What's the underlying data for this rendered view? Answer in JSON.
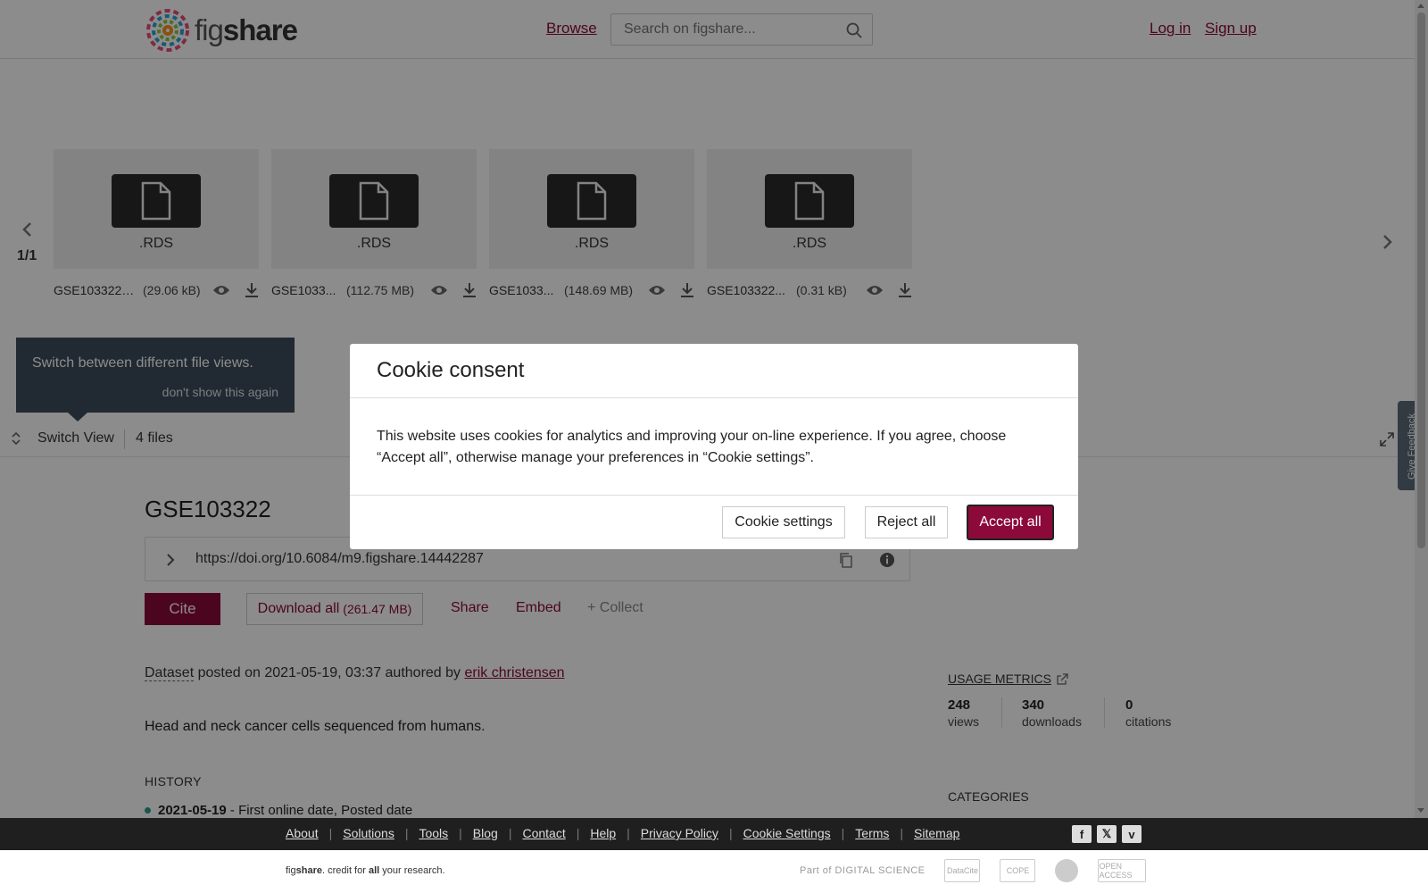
{
  "header": {
    "logo_text_light": "fig",
    "logo_text_bold": "share",
    "browse_label": "Browse",
    "search_placeholder": "Search on figshare...",
    "login_label": "Log in",
    "signup_label": "Sign up"
  },
  "carousel": {
    "page_indicator": "1/1",
    "files": [
      {
        "ext": ".RDS",
        "name": "GSE103322_...",
        "size": "(29.06 kB)"
      },
      {
        "ext": ".RDS",
        "name": "GSE1033...",
        "size": "(112.75 MB)"
      },
      {
        "ext": ".RDS",
        "name": "GSE1033...",
        "size": "(148.69 MB)"
      },
      {
        "ext": ".RDS",
        "name": "GSE103322...",
        "size": "(0.31 kB)"
      }
    ]
  },
  "tooltip": {
    "text": "Switch between different file views.",
    "dismiss": "don't show this again"
  },
  "switch_bar": {
    "label": "Switch View",
    "files_count": "4 files"
  },
  "item": {
    "title": "GSE103322",
    "doi": "https://doi.org/10.6084/m9.figshare.14442287",
    "cite_label": "Cite",
    "download_label": "Download all",
    "download_size": "(261.47 MB)",
    "share_label": "Share",
    "embed_label": "Embed",
    "collect_label": "+ Collect",
    "type": "Dataset",
    "posted_text": " posted on 2021-05-19, 03:37 authored by ",
    "author": "erik christensen",
    "description": "Head and neck cancer cells sequenced from humans.",
    "history_label": "HISTORY",
    "history_date": "2021-05-19",
    "history_text": " - First online date, Posted date"
  },
  "metrics": {
    "label": "USAGE METRICS",
    "views_value": "248",
    "views_label": "views",
    "downloads_value": "340",
    "downloads_label": "downloads",
    "citations_value": "0",
    "citations_label": "citations",
    "categories_label": "CATEGORIES"
  },
  "feedback_label": "Give Feedback",
  "cookie_modal": {
    "title": "Cookie consent",
    "body": "This website uses cookies for analytics and improving your on-line experience. If you agree, choose “Accept all”, otherwise manage your preferences in “Cookie settings”.",
    "settings_label": "Cookie settings",
    "reject_label": "Reject all",
    "accept_label": "Accept all"
  },
  "footer": {
    "links": [
      "About",
      "Solutions",
      "Tools",
      "Blog",
      "Contact",
      "Help",
      "Privacy Policy",
      "Cookie Settings",
      "Terms",
      "Sitemap"
    ],
    "social": [
      "f",
      "𝕏",
      "v"
    ],
    "tagline_brand_light": "fig",
    "tagline_brand_bold": "share",
    "tagline_rest_1": ". credit for ",
    "tagline_all": "all",
    "tagline_rest_2": " your research.",
    "partner_ds": "Part of DIGITAL SCIENCE",
    "partner_datacite": "DataCite",
    "partner_cope": "COPE",
    "partner_oa": "OPEN ACCESS"
  },
  "colors": {
    "brand": "#8b0a3a",
    "footer_bg": "#1f1f1f",
    "tooltip_bg": "#3d4e5c"
  }
}
